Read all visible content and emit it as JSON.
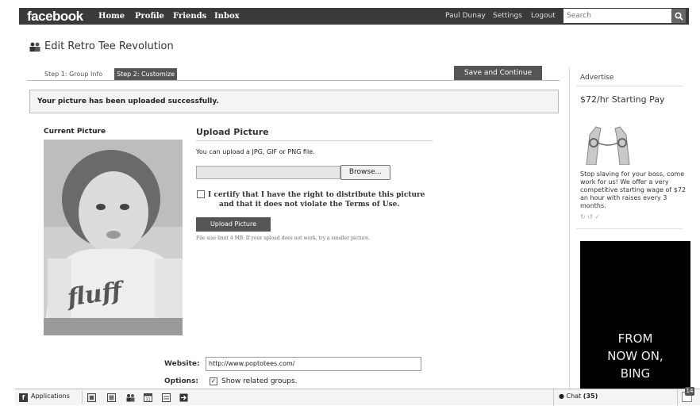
{
  "topbar": {
    "logo": "facebook",
    "nav": [
      "Home",
      "Profile",
      "Friends",
      "Inbox"
    ],
    "user": "Paul Dunay",
    "settings": "Settings",
    "logout": "Logout",
    "search_placeholder": "Search",
    "search_icon": "magnifier-icon"
  },
  "page": {
    "title": "Edit Retro Tee Revolution",
    "title_icon": "group-icon"
  },
  "tabs": [
    {
      "label": "Step 1: Group Info",
      "active": false
    },
    {
      "label": "Step 2: Customize",
      "active": true
    }
  ],
  "save_button": "Save and Continue",
  "message": "Your picture has been uploaded successfully.",
  "current_picture_label": "Current Picture",
  "photo_shirt_text": "fluff",
  "upload": {
    "heading": "Upload Picture",
    "help": "You can upload a JPG, GIF or PNG file.",
    "browse": "Browse...",
    "certify_line1": "I certify that I have the right to distribute this picture",
    "certify_line2": "and that it does not violate the Terms of Use.",
    "button": "Upload Picture",
    "limit": "File size limit 4 MB. If your upload does not work, try a smaller picture."
  },
  "form": {
    "website_label": "Website:",
    "website_value": "http://www.poptotees.com/",
    "options_label": "Options:",
    "options_text": "Show related groups.",
    "options_checked": true
  },
  "sidebar": {
    "advertise": "Advertise",
    "ad_title": "$72/hr Starting Pay",
    "ad_text": "Stop slaving for your boss, come work for us! We offer a very competitive starting wage of $72 an hour with raises every 3 months.",
    "ad_likes": "↻ ↺ ✓",
    "bing_line1": "FROM",
    "bing_line2": "NOW ON,",
    "bing_line3": "BING"
  },
  "bottombar": {
    "applications": "Applications",
    "chat_label": "Chat",
    "chat_count": "(35)",
    "notif_count": "14"
  }
}
